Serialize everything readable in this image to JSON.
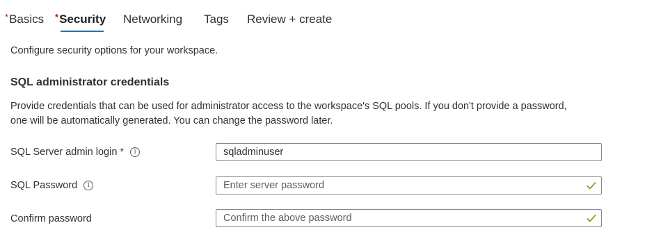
{
  "tabs": [
    {
      "label": "Basics",
      "required": "*"
    },
    {
      "label": "Security",
      "required": "*"
    },
    {
      "label": "Networking",
      "required": ""
    },
    {
      "label": "Tags",
      "required": ""
    },
    {
      "label": "Review + create",
      "required": ""
    }
  ],
  "active_tab": "Security",
  "accent_color": "#0078d4",
  "success_color": "#57a300",
  "required_color": "#a4262c",
  "intro": "Configure security options for your workspace.",
  "section": {
    "title": "SQL administrator credentials",
    "description_line1": "Provide credentials that can be used for administrator access to the workspace's SQL pools. If you don't provide a password,",
    "description_line2": "one will be automatically generated. You can change the password later."
  },
  "fields": {
    "admin_login": {
      "label": "SQL Server admin login",
      "required": "*",
      "value": "sqladminuser",
      "placeholder": ""
    },
    "password": {
      "label": "SQL Password",
      "value": "",
      "placeholder": "Enter server password",
      "valid": true
    },
    "confirm": {
      "label": "Confirm password",
      "value": "",
      "placeholder": "Confirm the above password",
      "valid": true
    }
  },
  "icons": {
    "info": "info-icon",
    "check": "checkmark-icon"
  }
}
